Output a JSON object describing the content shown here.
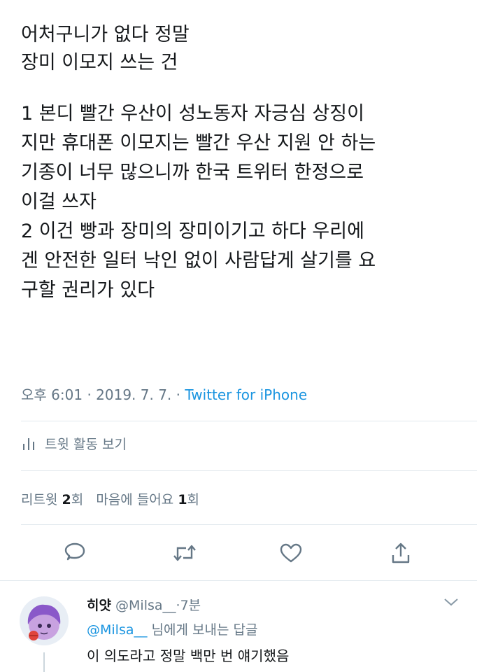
{
  "tweet": {
    "intro_lines": [
      "어처구니가 없다 정말",
      "장미 이모지 쓰는 건"
    ],
    "body_lines": [
      "1 본디 빨간 우산이 성노동자 자긍심 상징이",
      "지만 휴대폰 이모지는 빨간 우산 지원 안 하는",
      "기종이 너무 많으니까 한국 트위터 한정으로",
      "이걸 쓰자",
      "2 이건 빵과 장미의 장미이기고 하다 우리에",
      "겐 안전한 일터 낙인 없이 사람답게 살기를 요",
      "구할 권리가 있다"
    ],
    "time": "오후 6:01",
    "date": "2019. 7. 7.",
    "source": "Twitter for iPhone",
    "sep": "·"
  },
  "activity": {
    "label": "트윗 활동 보기",
    "icon": "bar-chart-icon"
  },
  "stats": {
    "retweet_label": "리트윗",
    "retweet_count": "2",
    "retweet_unit": "회",
    "like_label": "마음에 들어요",
    "like_count": "1",
    "like_unit": "회"
  },
  "actions": [
    {
      "name": "reply-button",
      "icon": "comment-icon"
    },
    {
      "name": "retweet-button",
      "icon": "retweet-icon"
    },
    {
      "name": "like-button",
      "icon": "heart-icon"
    },
    {
      "name": "share-button",
      "icon": "share-icon"
    }
  ],
  "reply": {
    "name": "히얏",
    "handle": "@Milsa__",
    "sep": "·",
    "time": "7분",
    "reply_to_handle": "@Milsa__",
    "reply_to_suffix": " 님에게 보내는 답글",
    "text": "이 의도라고 정말 백만 번 얘기했음"
  },
  "colors": {
    "accent": "#1b95e0",
    "muted": "#657786",
    "text": "#14171a",
    "border": "#e1e8ed"
  }
}
